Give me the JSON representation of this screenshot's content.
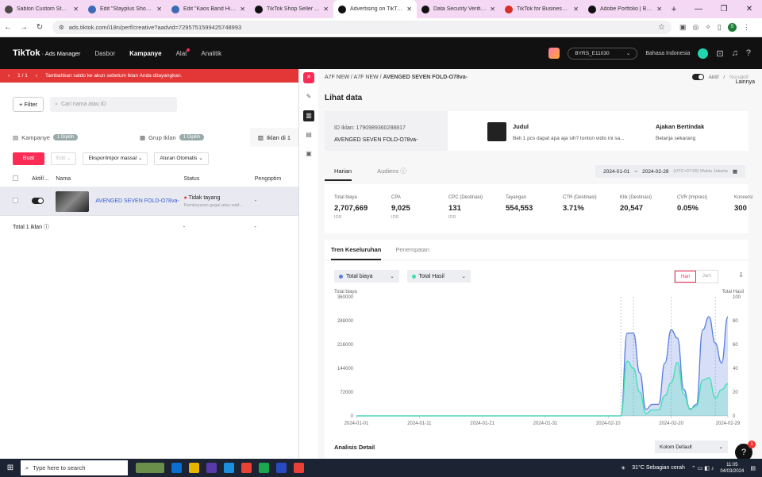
{
  "browser": {
    "tabs": [
      {
        "title": "Sablon Custom Stayplus",
        "color": "#4a4a4a"
      },
      {
        "title": "Edit \"Stayplus ShopTAB",
        "color": "#3c6bb5"
      },
      {
        "title": "Edit \"Kaos Band High Pre",
        "color": "#3c6bb5"
      },
      {
        "title": "TikTok Shop Seller Cente",
        "color": "#111111"
      },
      {
        "title": "Advertising on TikTok | Tik",
        "color": "#111111"
      },
      {
        "title": "Data Security Verification",
        "color": "#111111"
      },
      {
        "title": "TikTok for Business Verific",
        "color": "#d93025"
      },
      {
        "title": "Adobe Portfolio | Build yo",
        "color": "#111111"
      }
    ],
    "active_tab": 4,
    "url": "ads.tiktok.com/i18n/perf/creative?aadvid=7295751599425748993",
    "profile_initial": "S"
  },
  "topnav": {
    "logo": "TikTok",
    "logo_sub": "Ads Manager",
    "items": [
      "Dasbor",
      "Kampanye",
      "Alat",
      "Analitik"
    ],
    "account": "BYRS_E11030",
    "language": "Bahasa Indonesia"
  },
  "left": {
    "banner_pager": "1 / 1",
    "banner_text": "Tambahkan saldo ke akun sebelum iklan Anda ditayangkan.",
    "filter_label": "+ Filter",
    "search_placeholder": "Cari nama atau ID",
    "tiers": [
      {
        "label": "Kampanye",
        "pill": "1 Dipilih"
      },
      {
        "label": "Grup Iklan",
        "pill": "1 Dipilih"
      },
      {
        "label": "Iklan di 1"
      }
    ],
    "actions": {
      "create": "Buat",
      "edit": "Edit",
      "export": "Ekspor/impor massal",
      "rules": "Aturan Otomatis"
    },
    "columns": [
      "Aktif/...",
      "Nama",
      "Status",
      "Pengoptim"
    ],
    "row": {
      "name": "AVENGED SEVEN FOLD-O78va-",
      "status": "Tidak tayang",
      "status_sub": "Pembayaran gagal atau sald...",
      "opt": "-"
    },
    "footer": {
      "label": "Total 1 iklan",
      "status": "-",
      "opt": "-"
    }
  },
  "panel": {
    "crumb_prefix": "A7F NEW / A7F NEW /",
    "crumb_current": "AVENGED SEVEN FOLD-O78va-",
    "toggle_on": "Aktif",
    "toggle_off": "Nonaktif",
    "more": "Lainnya",
    "title": "Lihat data",
    "ad_id_label": "ID Iklan: 1790989360288817",
    "ad_name": "AVENGED SEVEN FOLD-O78va-",
    "judul_label": "Judul",
    "judul_text": "Beli 1 pcs dapat apa aja sih? tonton vidio ini sa...",
    "cta_label": "Ajakan Bertindak",
    "cta_text": "Belanja sekarang",
    "tabs": [
      "Harian",
      "Audiens"
    ],
    "date_start": "2024-01-01",
    "date_end": "2024-02-29",
    "timezone": "(UTC+07:00) Waktu Jakarta",
    "metrics": [
      {
        "label": "Total biaya",
        "value": "2,707,669",
        "unit": "IDR"
      },
      {
        "label": "CPA",
        "value": "9,025",
        "unit": "IDR"
      },
      {
        "label": "CPC (Destinasi)",
        "value": "131",
        "unit": "IDR"
      },
      {
        "label": "Tayangan",
        "value": "554,553",
        "unit": ""
      },
      {
        "label": "CTR (Destinasi)",
        "value": "3.71%",
        "unit": ""
      },
      {
        "label": "Klik (Destinasi)",
        "value": "20,547",
        "unit": ""
      },
      {
        "label": "CVR (Impresi)",
        "value": "0.05%",
        "unit": ""
      },
      {
        "label": "Konversi",
        "value": "300",
        "unit": ""
      }
    ],
    "chart_tabs": [
      "Tren Keseluruhan",
      "Penempatan"
    ],
    "select1": "Total biaya",
    "select2": "Total Hasil",
    "granularity": [
      "Hari",
      "Jam"
    ],
    "analisis": "Analisis Detail",
    "kolom": "Kolom Default"
  },
  "chart_data": {
    "type": "area",
    "left_axis_label": "Total biaya",
    "right_axis_label": "Total Hasil",
    "left_ticks": [
      "360000",
      "288000",
      "216000",
      "144000",
      "72000",
      "0"
    ],
    "right_ticks": [
      "100",
      "80",
      "60",
      "40",
      "20",
      "0"
    ],
    "x_ticks": [
      "2024-01-01",
      "2024-01-11",
      "2024-01-21",
      "2024-01-31",
      "2024-02-10",
      "2024-02-20",
      "2024-02-29"
    ],
    "ylim_left": [
      0,
      360000
    ],
    "ylim_right": [
      0,
      100
    ],
    "x_start": "2024-01-01",
    "x": [
      "2024-02-12",
      "2024-02-13",
      "2024-02-14",
      "2024-02-15",
      "2024-02-16",
      "2024-02-17",
      "2024-02-18",
      "2024-02-19",
      "2024-02-20",
      "2024-02-21",
      "2024-02-22",
      "2024-02-23",
      "2024-02-24",
      "2024-02-25",
      "2024-02-26",
      "2024-02-27",
      "2024-02-28",
      "2024-02-29"
    ],
    "series": [
      {
        "name": "Total biaya",
        "color": "#5b7ee0",
        "values": [
          0,
          250000,
          250000,
          130000,
          20000,
          35000,
          35000,
          160000,
          260000,
          235000,
          80000,
          20000,
          35000,
          260000,
          300000,
          220000,
          160000,
          300000
        ]
      },
      {
        "name": "Total Hasil",
        "color": "#3fe0b2",
        "values": [
          0,
          46,
          40,
          20,
          2,
          5,
          5,
          17,
          28,
          45,
          18,
          6,
          8,
          30,
          32,
          15,
          22,
          27
        ]
      }
    ],
    "grid": false
  },
  "taskbar": {
    "search_placeholder": "Type here to search",
    "weather": "31°C  Sebagian cerah",
    "time": "11:05",
    "date": "04/03/2024"
  }
}
